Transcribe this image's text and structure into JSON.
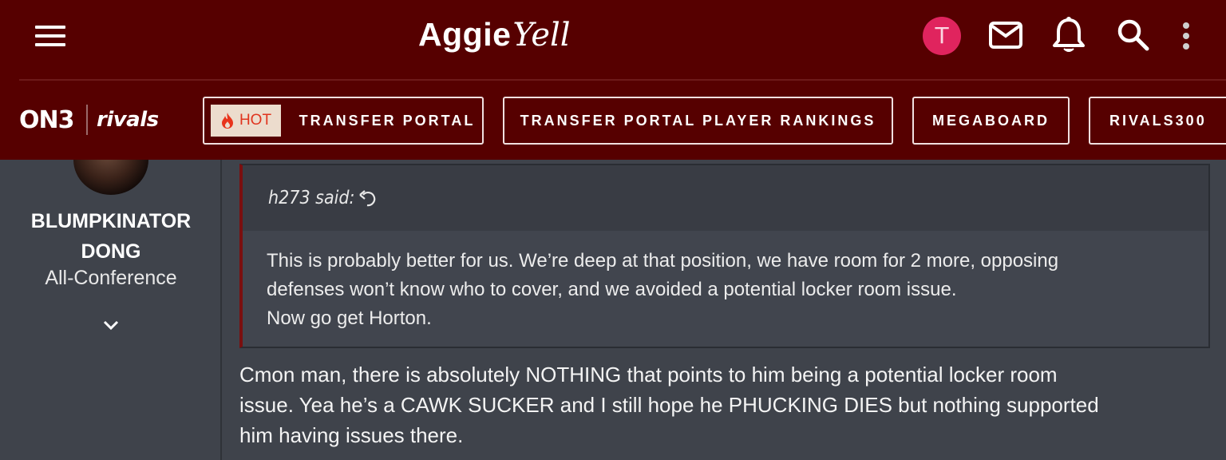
{
  "header": {
    "logo_main": "Aggie",
    "logo_script": "Yell",
    "user_initial": "T"
  },
  "brand": {
    "on3": "ON3",
    "rivals": "rivals"
  },
  "nav": {
    "hot_badge": "HOT",
    "items": [
      {
        "label": "TRANSFER PORTAL"
      },
      {
        "label": "TRANSFER PORTAL PLAYER RANKINGS"
      },
      {
        "label": "MEGABOARD"
      },
      {
        "label": "RIVALS300"
      }
    ]
  },
  "user": {
    "name_line1": "BLUMPKINATOR",
    "name_line2": "DONG",
    "title": "All-Conference"
  },
  "quote": {
    "author": "h273 said:",
    "lines": [
      "This is probably better for us. We’re deep at that position, we have room for 2 more, opposing",
      "defenses won’t know who to cover, and we avoided a potential locker room issue.",
      "Now go get Horton."
    ]
  },
  "post": {
    "lines": [
      "Cmon man, there is absolutely NOTHING that points to him being a potential locker room",
      "issue. Yea he’s a CAWK SUCKER and I still hope he PHUCKING DIES but nothing supported",
      "him having issues there."
    ]
  },
  "colors": {
    "header_bg": "#560000",
    "avatar_bg": "#e0245e",
    "hot_text": "#e0341e",
    "quote_border": "#7a0f0f",
    "page_bg": "#3f434b"
  },
  "icons": [
    "menu-icon",
    "mail-icon",
    "bell-icon",
    "search-icon",
    "more-vertical-icon",
    "flame-icon",
    "reply-arrow-icon",
    "chevron-down-icon"
  ]
}
